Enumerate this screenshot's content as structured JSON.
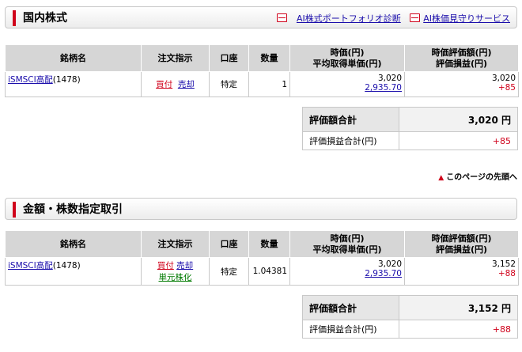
{
  "sections": [
    {
      "title": "国内株式",
      "links": [
        "AI株式ポートフォリオ診断",
        "AI株価見守りサービス"
      ],
      "headers": {
        "name": "銘柄名",
        "order": "注文指示",
        "account": "口座",
        "qty": "数量",
        "price_line1": "時価(円)",
        "price_line2": "平均取得単価(円)",
        "valuation_line1": "時価評価額(円)",
        "valuation_line2": "評価損益(円)"
      },
      "row": {
        "name": "iSMSCI高配",
        "code": "(1478)",
        "buy": "買付",
        "sell": "売却",
        "unit": "",
        "account": "特定",
        "qty": "1",
        "price": "3,020",
        "avg_price": "2,935.70",
        "valuation": "3,020",
        "pl": "+85"
      },
      "summary": {
        "total_label": "評価額合計",
        "total_value": "3,020 円",
        "pl_label": "評価損益合計(円)",
        "pl_value": "+85"
      }
    },
    {
      "title": "金額・株数指定取引",
      "headers": {
        "name": "銘柄名",
        "order": "注文指示",
        "account": "口座",
        "qty": "数量",
        "price_line1": "時価(円)",
        "price_line2": "平均取得単価(円)",
        "valuation_line1": "時価評価額(円)",
        "valuation_line2": "評価損益(円)"
      },
      "row": {
        "name": "iSMSCI高配",
        "code": "(1478)",
        "buy": "買付",
        "sell": "売却",
        "unit": "単元株化",
        "account": "特定",
        "qty": "1.04381",
        "price": "3,020",
        "avg_price": "2,935.70",
        "valuation": "3,152",
        "pl": "+88"
      },
      "summary": {
        "total_label": "評価額合計",
        "total_value": "3,152 円",
        "pl_label": "評価損益合計(円)",
        "pl_value": "+88"
      }
    }
  ],
  "page_top": "このページの先頭へ"
}
